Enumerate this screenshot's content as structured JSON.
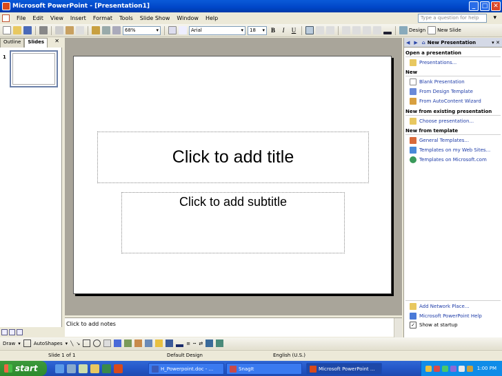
{
  "window": {
    "title": "Microsoft PowerPoint - [Presentation1]"
  },
  "menu": {
    "items": [
      "File",
      "Edit",
      "View",
      "Insert",
      "Format",
      "Tools",
      "Slide Show",
      "Window",
      "Help"
    ],
    "help_placeholder": "Type a question for help"
  },
  "toolbar": {
    "zoom": "68%",
    "font": "Arial",
    "font_size": "18",
    "bold": "B",
    "italic": "I",
    "underline": "U",
    "design_label": "Design",
    "new_slide_label": "New Slide"
  },
  "left_pane": {
    "tabs": [
      "Outline",
      "Slides"
    ],
    "close": "✕",
    "slide_number": "1"
  },
  "slide": {
    "title_placeholder": "Click to add title",
    "subtitle_placeholder": "Click to add subtitle"
  },
  "notes": {
    "placeholder": "Click to add notes"
  },
  "task_pane": {
    "title": "New Presentation",
    "sections": [
      {
        "heading": "Open a presentation",
        "links": [
          "Presentations..."
        ]
      },
      {
        "heading": "New",
        "links": [
          "Blank Presentation",
          "From Design Template",
          "From AutoContent Wizard"
        ]
      },
      {
        "heading": "New from existing presentation",
        "links": [
          "Choose presentation..."
        ]
      },
      {
        "heading": "New from template",
        "links": [
          "General Templates...",
          "Templates on my Web Sites...",
          "Templates on Microsoft.com"
        ]
      }
    ],
    "footer_links": [
      "Add Network Place...",
      "Microsoft PowerPoint Help"
    ],
    "show_at_startup": "Show at startup"
  },
  "drawing": {
    "draw_label": "Draw",
    "autoshapes_label": "AutoShapes"
  },
  "status": {
    "slide": "Slide 1 of 1",
    "design": "Default Design",
    "language": "English (U.S.)"
  },
  "taskbar": {
    "start_label": "start",
    "tasks": [
      "H_Powerpoint.doc - ...",
      "SnagIt",
      "Microsoft PowerPoint ..."
    ],
    "clock": "1:00 PM"
  }
}
